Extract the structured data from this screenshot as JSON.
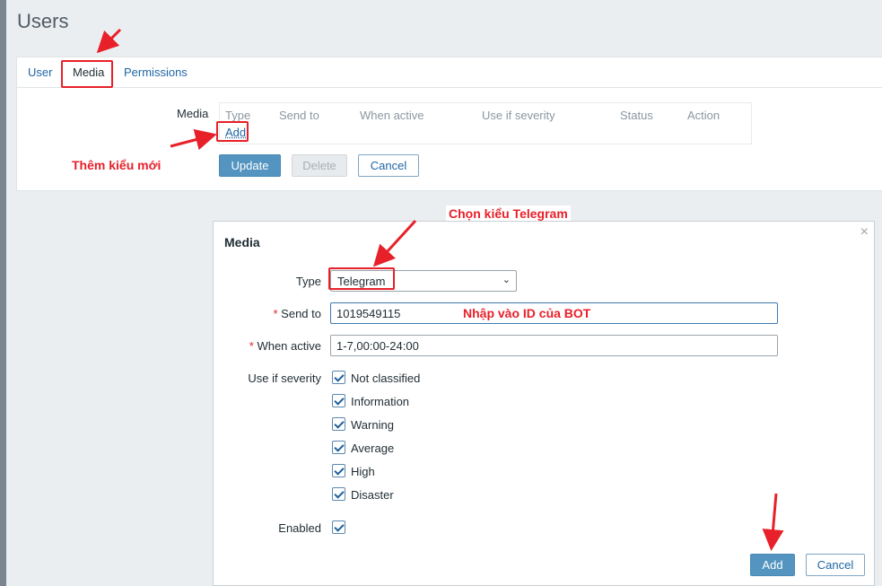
{
  "page": {
    "title": "Users"
  },
  "tabs": [
    {
      "label": "User"
    },
    {
      "label": "Media"
    },
    {
      "label": "Permissions"
    }
  ],
  "media_section": {
    "label": "Media",
    "columns": [
      "Type",
      "Send to",
      "When active",
      "Use if severity",
      "Status",
      "Action"
    ],
    "add_link": "Add"
  },
  "form_buttons": {
    "update": "Update",
    "delete": "Delete",
    "cancel": "Cancel"
  },
  "annotations": {
    "add_new_type": "Thêm kiểu mới",
    "choose_telegram": "Chọn kiểu Telegram",
    "enter_bot_id": "Nhập vào ID của BOT"
  },
  "dialog": {
    "title": "Media",
    "close_symbol": "×",
    "type_label": "Type",
    "type_value": "Telegram",
    "send_to_label": "Send to",
    "send_to_value": "1019549115",
    "when_active_label": "When active",
    "when_active_value": "1-7,00:00-24:00",
    "required_mark": "*",
    "severity_label": "Use if severity",
    "severities": [
      "Not classified",
      "Information",
      "Warning",
      "Average",
      "High",
      "Disaster"
    ],
    "enabled_label": "Enabled",
    "add_button": "Add",
    "cancel_button": "Cancel"
  },
  "colors": {
    "annotation": "#e8202a",
    "primary": "#5394c0",
    "link": "#1f65a6"
  }
}
